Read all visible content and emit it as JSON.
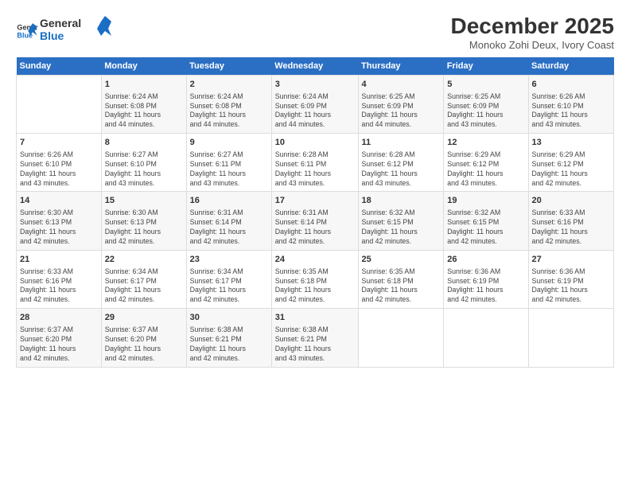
{
  "header": {
    "logo_line1": "General",
    "logo_line2": "Blue",
    "title": "December 2025",
    "subtitle": "Monoko Zohi Deux, Ivory Coast"
  },
  "calendar": {
    "headers": [
      "Sunday",
      "Monday",
      "Tuesday",
      "Wednesday",
      "Thursday",
      "Friday",
      "Saturday"
    ],
    "weeks": [
      [
        {
          "day": "",
          "info": ""
        },
        {
          "day": "1",
          "info": "Sunrise: 6:24 AM\nSunset: 6:08 PM\nDaylight: 11 hours\nand 44 minutes."
        },
        {
          "day": "2",
          "info": "Sunrise: 6:24 AM\nSunset: 6:08 PM\nDaylight: 11 hours\nand 44 minutes."
        },
        {
          "day": "3",
          "info": "Sunrise: 6:24 AM\nSunset: 6:09 PM\nDaylight: 11 hours\nand 44 minutes."
        },
        {
          "day": "4",
          "info": "Sunrise: 6:25 AM\nSunset: 6:09 PM\nDaylight: 11 hours\nand 44 minutes."
        },
        {
          "day": "5",
          "info": "Sunrise: 6:25 AM\nSunset: 6:09 PM\nDaylight: 11 hours\nand 43 minutes."
        },
        {
          "day": "6",
          "info": "Sunrise: 6:26 AM\nSunset: 6:10 PM\nDaylight: 11 hours\nand 43 minutes."
        }
      ],
      [
        {
          "day": "7",
          "info": "Sunrise: 6:26 AM\nSunset: 6:10 PM\nDaylight: 11 hours\nand 43 minutes."
        },
        {
          "day": "8",
          "info": "Sunrise: 6:27 AM\nSunset: 6:10 PM\nDaylight: 11 hours\nand 43 minutes."
        },
        {
          "day": "9",
          "info": "Sunrise: 6:27 AM\nSunset: 6:11 PM\nDaylight: 11 hours\nand 43 minutes."
        },
        {
          "day": "10",
          "info": "Sunrise: 6:28 AM\nSunset: 6:11 PM\nDaylight: 11 hours\nand 43 minutes."
        },
        {
          "day": "11",
          "info": "Sunrise: 6:28 AM\nSunset: 6:12 PM\nDaylight: 11 hours\nand 43 minutes."
        },
        {
          "day": "12",
          "info": "Sunrise: 6:29 AM\nSunset: 6:12 PM\nDaylight: 11 hours\nand 43 minutes."
        },
        {
          "day": "13",
          "info": "Sunrise: 6:29 AM\nSunset: 6:12 PM\nDaylight: 11 hours\nand 42 minutes."
        }
      ],
      [
        {
          "day": "14",
          "info": "Sunrise: 6:30 AM\nSunset: 6:13 PM\nDaylight: 11 hours\nand 42 minutes."
        },
        {
          "day": "15",
          "info": "Sunrise: 6:30 AM\nSunset: 6:13 PM\nDaylight: 11 hours\nand 42 minutes."
        },
        {
          "day": "16",
          "info": "Sunrise: 6:31 AM\nSunset: 6:14 PM\nDaylight: 11 hours\nand 42 minutes."
        },
        {
          "day": "17",
          "info": "Sunrise: 6:31 AM\nSunset: 6:14 PM\nDaylight: 11 hours\nand 42 minutes."
        },
        {
          "day": "18",
          "info": "Sunrise: 6:32 AM\nSunset: 6:15 PM\nDaylight: 11 hours\nand 42 minutes."
        },
        {
          "day": "19",
          "info": "Sunrise: 6:32 AM\nSunset: 6:15 PM\nDaylight: 11 hours\nand 42 minutes."
        },
        {
          "day": "20",
          "info": "Sunrise: 6:33 AM\nSunset: 6:16 PM\nDaylight: 11 hours\nand 42 minutes."
        }
      ],
      [
        {
          "day": "21",
          "info": "Sunrise: 6:33 AM\nSunset: 6:16 PM\nDaylight: 11 hours\nand 42 minutes."
        },
        {
          "day": "22",
          "info": "Sunrise: 6:34 AM\nSunset: 6:17 PM\nDaylight: 11 hours\nand 42 minutes."
        },
        {
          "day": "23",
          "info": "Sunrise: 6:34 AM\nSunset: 6:17 PM\nDaylight: 11 hours\nand 42 minutes."
        },
        {
          "day": "24",
          "info": "Sunrise: 6:35 AM\nSunset: 6:18 PM\nDaylight: 11 hours\nand 42 minutes."
        },
        {
          "day": "25",
          "info": "Sunrise: 6:35 AM\nSunset: 6:18 PM\nDaylight: 11 hours\nand 42 minutes."
        },
        {
          "day": "26",
          "info": "Sunrise: 6:36 AM\nSunset: 6:19 PM\nDaylight: 11 hours\nand 42 minutes."
        },
        {
          "day": "27",
          "info": "Sunrise: 6:36 AM\nSunset: 6:19 PM\nDaylight: 11 hours\nand 42 minutes."
        }
      ],
      [
        {
          "day": "28",
          "info": "Sunrise: 6:37 AM\nSunset: 6:20 PM\nDaylight: 11 hours\nand 42 minutes."
        },
        {
          "day": "29",
          "info": "Sunrise: 6:37 AM\nSunset: 6:20 PM\nDaylight: 11 hours\nand 42 minutes."
        },
        {
          "day": "30",
          "info": "Sunrise: 6:38 AM\nSunset: 6:21 PM\nDaylight: 11 hours\nand 42 minutes."
        },
        {
          "day": "31",
          "info": "Sunrise: 6:38 AM\nSunset: 6:21 PM\nDaylight: 11 hours\nand 43 minutes."
        },
        {
          "day": "",
          "info": ""
        },
        {
          "day": "",
          "info": ""
        },
        {
          "day": "",
          "info": ""
        }
      ]
    ]
  }
}
